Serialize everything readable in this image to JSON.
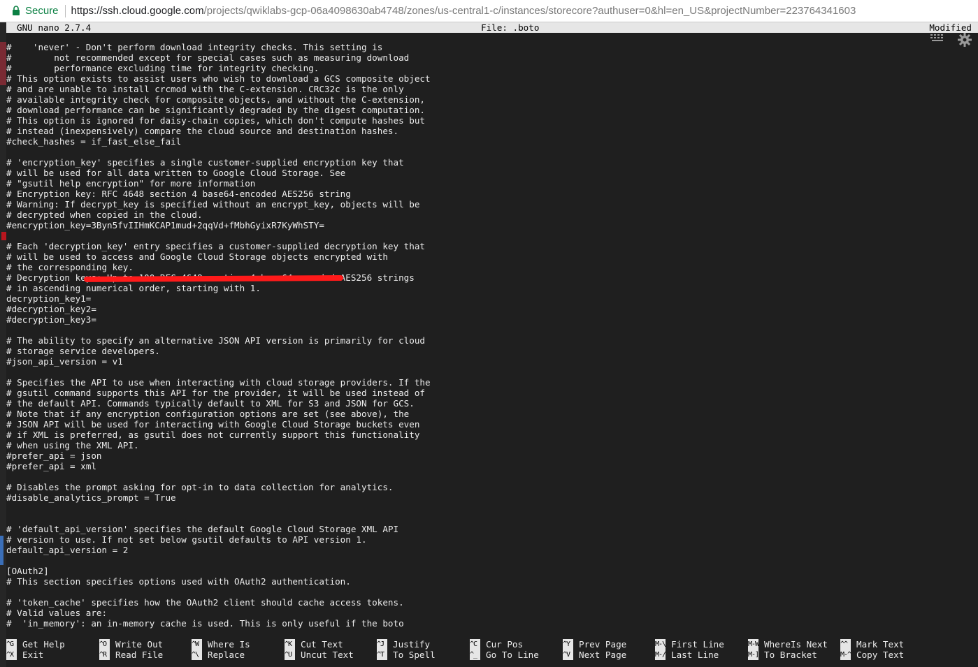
{
  "browser": {
    "secure_label": "Secure",
    "url_host": "https://ssh.cloud.google.com",
    "url_path": "/projects/qwiklabs-gcp-06a4098630ab4748/zones/us-central1-c/instances/storecore?authuser=0&hl=en_US&projectNumber=223764341603",
    "secure_color": "#0b8043"
  },
  "nano": {
    "version": "GNU nano 2.7.4",
    "file": "File: .boto",
    "status": "Modified"
  },
  "icons": [
    "lock-icon",
    "keyboard-icon",
    "gear-icon"
  ],
  "lines": [
    "#    'never' - Don't perform download integrity checks. This setting is",
    "#        not recommended except for special cases such as measuring download",
    "#        performance excluding time for integrity checking.",
    "# This option exists to assist users who wish to download a GCS composite object",
    "# and are unable to install crcmod with the C-extension. CRC32c is the only",
    "# available integrity check for composite objects, and without the C-extension,",
    "# download performance can be significantly degraded by the digest computation.",
    "# This option is ignored for daisy-chain copies, which don't compute hashes but",
    "# instead (inexpensively) compare the cloud source and destination hashes.",
    "#check_hashes = if_fast_else_fail",
    "",
    "# 'encryption_key' specifies a single customer-supplied encryption key that",
    "# will be used for all data written to Google Cloud Storage. See",
    "# \"gsutil help encryption\" for more information",
    "# Encryption key: RFC 4648 section 4 base64-encoded AES256 string",
    "# Warning: If decrypt_key is specified without an encrypt_key, objects will be",
    "# decrypted when copied in the cloud.",
    "#encryption_key=3Byn5fvIIHmKCAP1mud+2qqVd+fMbhGyixR7KyWhSTY=",
    "",
    "# Each 'decryption_key' entry specifies a customer-supplied decryption key that",
    "# will be used to access and Google Cloud Storage objects encrypted with",
    "# the corresponding key.",
    "# Decryption keys: Up to 100 RFC 4648 section 4 base64-encoded AES256 strings",
    "# in ascending numerical order, starting with 1.",
    "decryption_key1=",
    "#decryption_key2=",
    "#decryption_key3=",
    "",
    "# The ability to specify an alternative JSON API version is primarily for cloud",
    "# storage service developers.",
    "#json_api_version = v1",
    "",
    "# Specifies the API to use when interacting with cloud storage providers. If the",
    "# gsutil command supports this API for the provider, it will be used instead of",
    "# the default API. Commands typically default to XML for S3 and JSON for GCS.",
    "# Note that if any encryption configuration options are set (see above), the",
    "# JSON API will be used for interacting with Google Cloud Storage buckets even",
    "# if XML is preferred, as gsutil does not currently support this functionality",
    "# when using the XML API.",
    "#prefer_api = json",
    "#prefer_api = xml",
    "",
    "# Disables the prompt asking for opt-in to data collection for analytics.",
    "#disable_analytics_prompt = True",
    "",
    "",
    "# 'default_api_version' specifies the default Google Cloud Storage XML API",
    "# version to use. If not set below gsutil defaults to API version 1.",
    "default_api_version = 2",
    "",
    "[OAuth2]",
    "# This section specifies options used with OAuth2 authentication.",
    "",
    "# 'token_cache' specifies how the OAuth2 client should cache access tokens.",
    "# Valid values are:",
    "#  'in_memory': an in-memory cache is used. This is only useful if the boto"
  ],
  "shortcuts": [
    {
      "k1": "^G",
      "l1": "Get Help",
      "k2": "^X",
      "l2": "Exit"
    },
    {
      "k1": "^O",
      "l1": "Write Out",
      "k2": "^R",
      "l2": "Read File"
    },
    {
      "k1": "^W",
      "l1": "Where Is",
      "k2": "^\\",
      "l2": "Replace"
    },
    {
      "k1": "^K",
      "l1": "Cut Text",
      "k2": "^U",
      "l2": "Uncut Text"
    },
    {
      "k1": "^J",
      "l1": "Justify",
      "k2": "^T",
      "l2": "To Spell"
    },
    {
      "k1": "^C",
      "l1": "Cur Pos",
      "k2": "^_",
      "l2": "Go To Line"
    },
    {
      "k1": "^Y",
      "l1": "Prev Page",
      "k2": "^V",
      "l2": "Next Page"
    },
    {
      "k1": "M-\\",
      "l1": "First Line",
      "k2": "M-/",
      "l2": "Last Line"
    },
    {
      "k1": "M-W",
      "l1": "WhereIs Next",
      "k2": "M-]",
      "l2": "To Bracket"
    },
    {
      "k1": "^^",
      "l1": "Mark Text",
      "k2": "M-^",
      "l2": "Copy Text"
    }
  ]
}
